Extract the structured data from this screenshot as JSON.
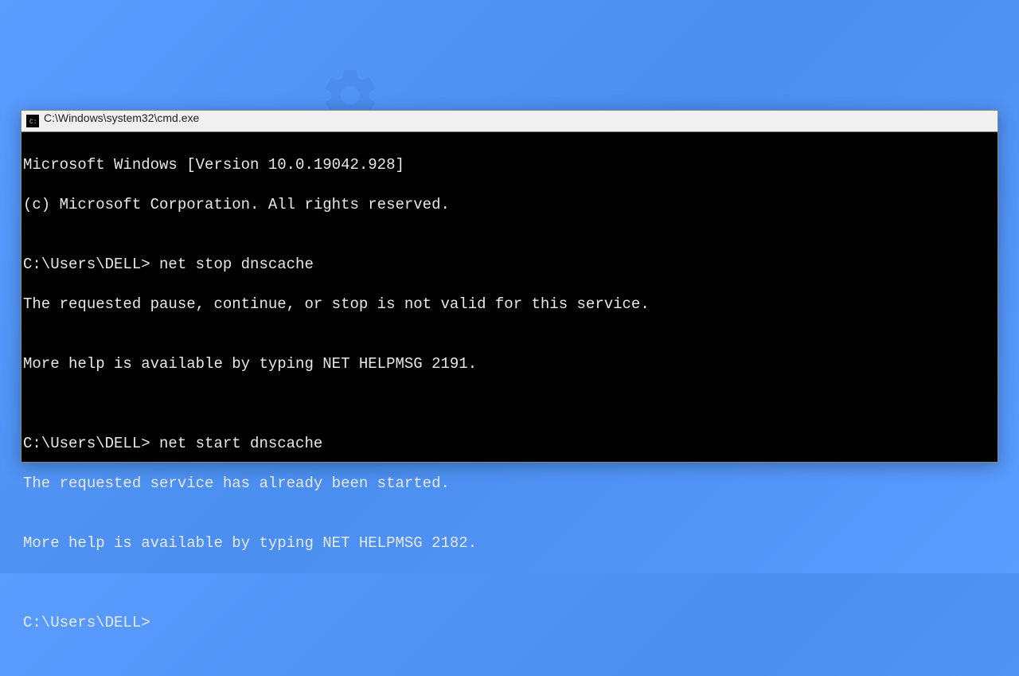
{
  "window": {
    "title": "C:\\Windows\\system32\\cmd.exe"
  },
  "terminal": {
    "lines": [
      "Microsoft Windows [Version 10.0.19042.928]",
      "(c) Microsoft Corporation. All rights reserved.",
      "",
      "C:\\Users\\DELL> net stop dnscache",
      "The requested pause, continue, or stop is not valid for this service.",
      "",
      "More help is available by typing NET HELPMSG 2191.",
      "",
      "",
      "C:\\Users\\DELL> net start dnscache",
      "The requested service has already been started.",
      "",
      "More help is available by typing NET HELPMSG 2182.",
      "",
      "",
      "C:\\Users\\DELL>"
    ]
  }
}
